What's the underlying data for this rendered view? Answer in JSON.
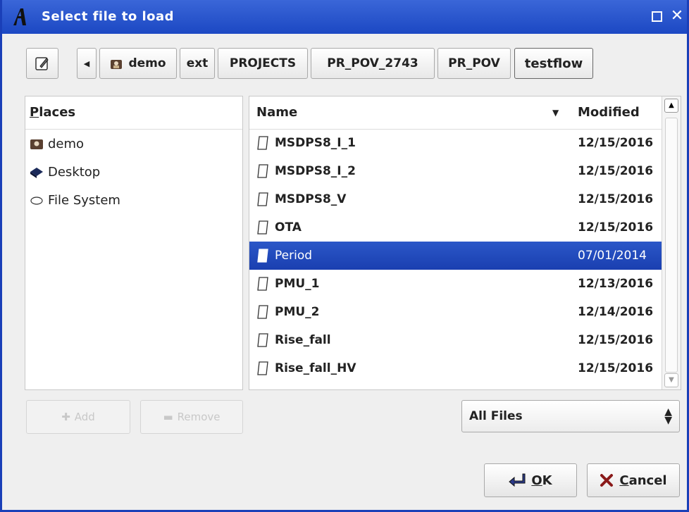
{
  "window": {
    "title": "Select file to load"
  },
  "pathbar": {
    "crumbs": [
      "demo",
      "ext",
      "PROJECTS",
      "PR_POV_2743",
      "PR_POV",
      "testflow"
    ]
  },
  "places": {
    "header": "Places",
    "items": [
      "demo",
      "Desktop",
      "File System"
    ]
  },
  "files": {
    "columns": {
      "name": "Name",
      "modified": "Modified"
    },
    "rows": [
      {
        "name": "MSDPS8_I_1",
        "modified": "12/15/2016"
      },
      {
        "name": "MSDPS8_I_2",
        "modified": "12/15/2016"
      },
      {
        "name": "MSDPS8_V",
        "modified": "12/15/2016"
      },
      {
        "name": "OTA",
        "modified": "12/15/2016"
      },
      {
        "name": "Period",
        "modified": "07/01/2014"
      },
      {
        "name": "PMU_1",
        "modified": "12/13/2016"
      },
      {
        "name": "PMU_2",
        "modified": "12/14/2016"
      },
      {
        "name": "Rise_fall",
        "modified": "12/15/2016"
      },
      {
        "name": "Rise_fall_HV",
        "modified": "12/15/2016"
      }
    ],
    "selected": "Period"
  },
  "buttons": {
    "add": "Add",
    "remove": "Remove",
    "ok_accel": "O",
    "ok_rest": "K",
    "cancel_accel": "C",
    "cancel_rest": "ancel"
  },
  "filter": {
    "value": "All Files"
  },
  "colors": {
    "titlebar": "#1c48c3",
    "selection": "#1a3fb0"
  },
  "icons": {
    "app": "app-logo-icon",
    "edit": "edit-location-icon",
    "home": "home-folder-icon",
    "desktop": "desktop-icon",
    "filesystem": "drive-icon",
    "file": "file-icon",
    "ok": "ok-arrow-icon",
    "cancel": "cancel-x-icon"
  }
}
